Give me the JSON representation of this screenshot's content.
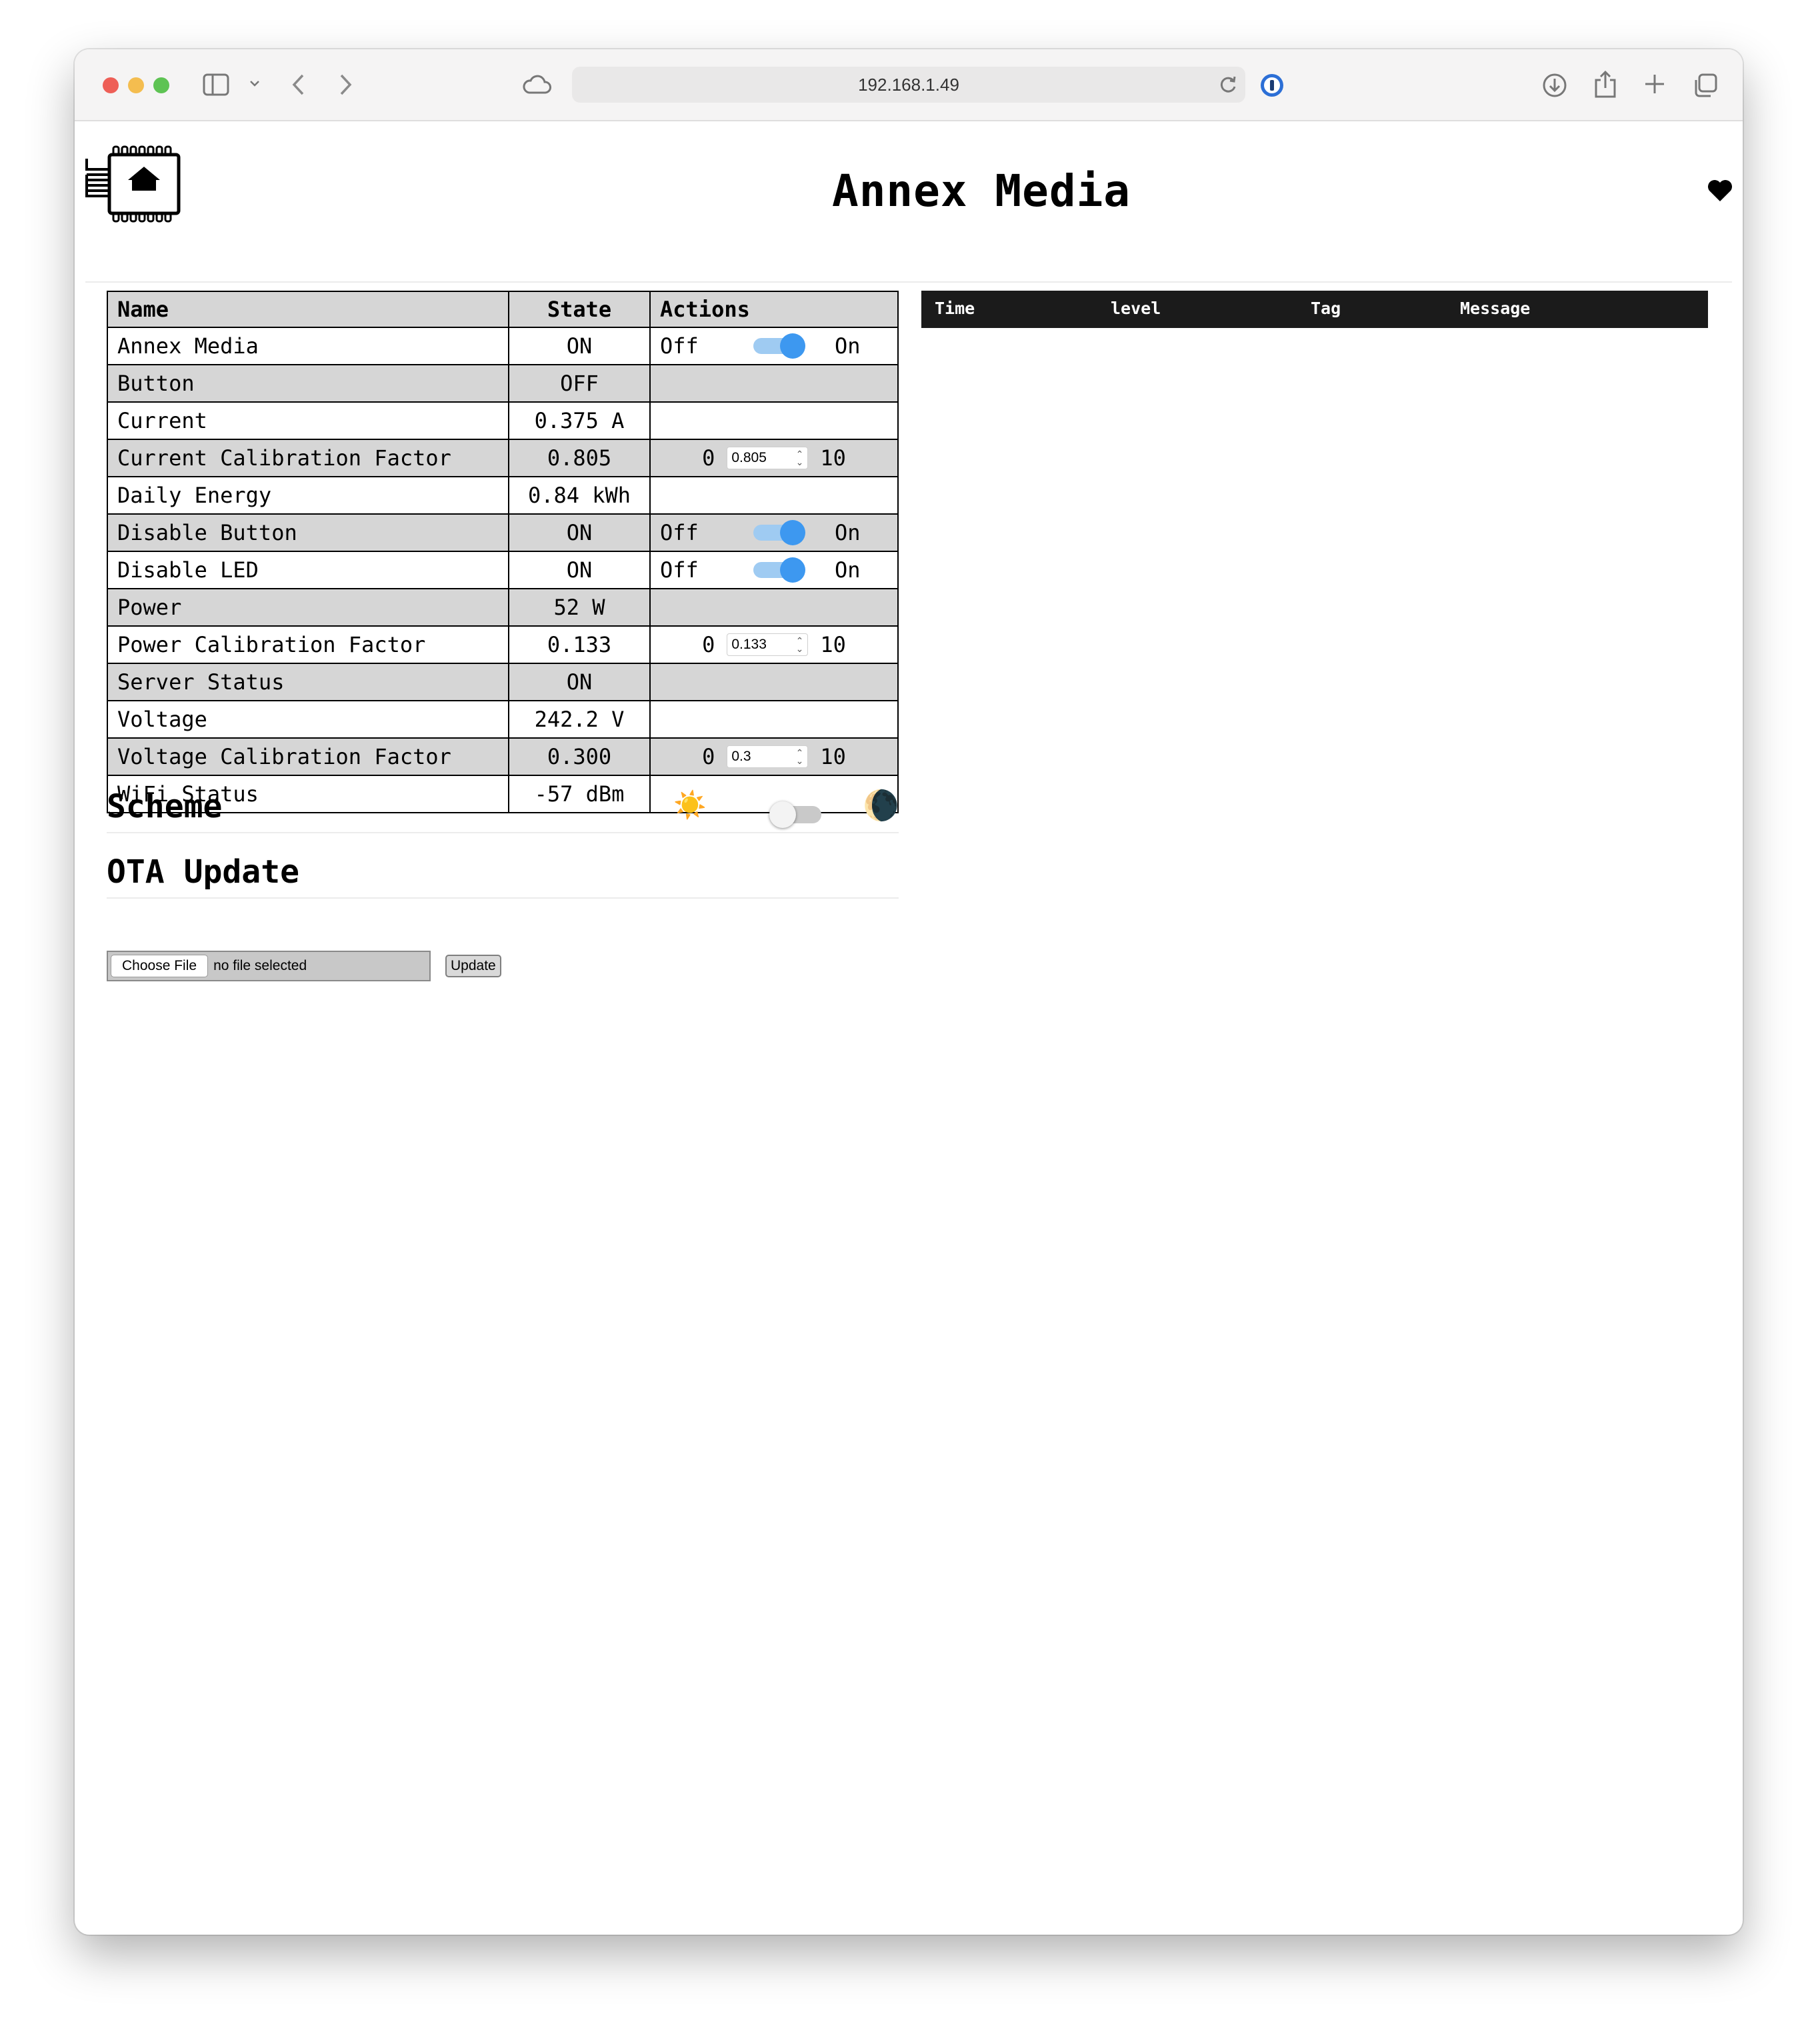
{
  "browser": {
    "url": "192.168.1.49"
  },
  "header": {
    "title": "Annex Media"
  },
  "devices": {
    "columns": [
      "Name",
      "State",
      "Actions"
    ],
    "rows": [
      {
        "name": "Annex Media",
        "state": "ON",
        "action": "switch",
        "checked": true
      },
      {
        "name": "Button",
        "state": "OFF",
        "action": "none"
      },
      {
        "name": "Current",
        "state": "0.375 A",
        "action": "none"
      },
      {
        "name": "Current Calibration Factor",
        "state": "0.805",
        "action": "number",
        "min": "0",
        "max": "10",
        "value": "0.805"
      },
      {
        "name": "Daily Energy",
        "state": "0.84 kWh",
        "action": "none"
      },
      {
        "name": "Disable Button",
        "state": "ON",
        "action": "switch",
        "checked": true
      },
      {
        "name": "Disable LED",
        "state": "ON",
        "action": "switch",
        "checked": true
      },
      {
        "name": "Power",
        "state": "52 W",
        "action": "none"
      },
      {
        "name": "Power Calibration Factor",
        "state": "0.133",
        "action": "number",
        "min": "0",
        "max": "10",
        "value": "0.133"
      },
      {
        "name": "Server Status",
        "state": "ON",
        "action": "none"
      },
      {
        "name": "Voltage",
        "state": "242.2 V",
        "action": "none"
      },
      {
        "name": "Voltage Calibration Factor",
        "state": "0.300",
        "action": "number",
        "min": "0",
        "max": "10",
        "value": "0.3"
      },
      {
        "name": "WiFi Status",
        "state": "-57 dBm",
        "action": "none"
      }
    ],
    "switch_off_label": "Off",
    "switch_on_label": "On"
  },
  "scheme": {
    "title": "Scheme",
    "sun": "☀️",
    "moon": "🌘",
    "dark_enabled": false
  },
  "ota": {
    "title": "OTA Update",
    "choose_label": "Choose File",
    "file_status": "no file selected",
    "update_label": "Update"
  },
  "log": {
    "columns": [
      "Time",
      "level",
      "Tag",
      "Message"
    ]
  },
  "colors": {
    "switch_on": "#3d98f0",
    "alt_row": "#d6d6d6",
    "log_header": "#1b1b1b"
  }
}
